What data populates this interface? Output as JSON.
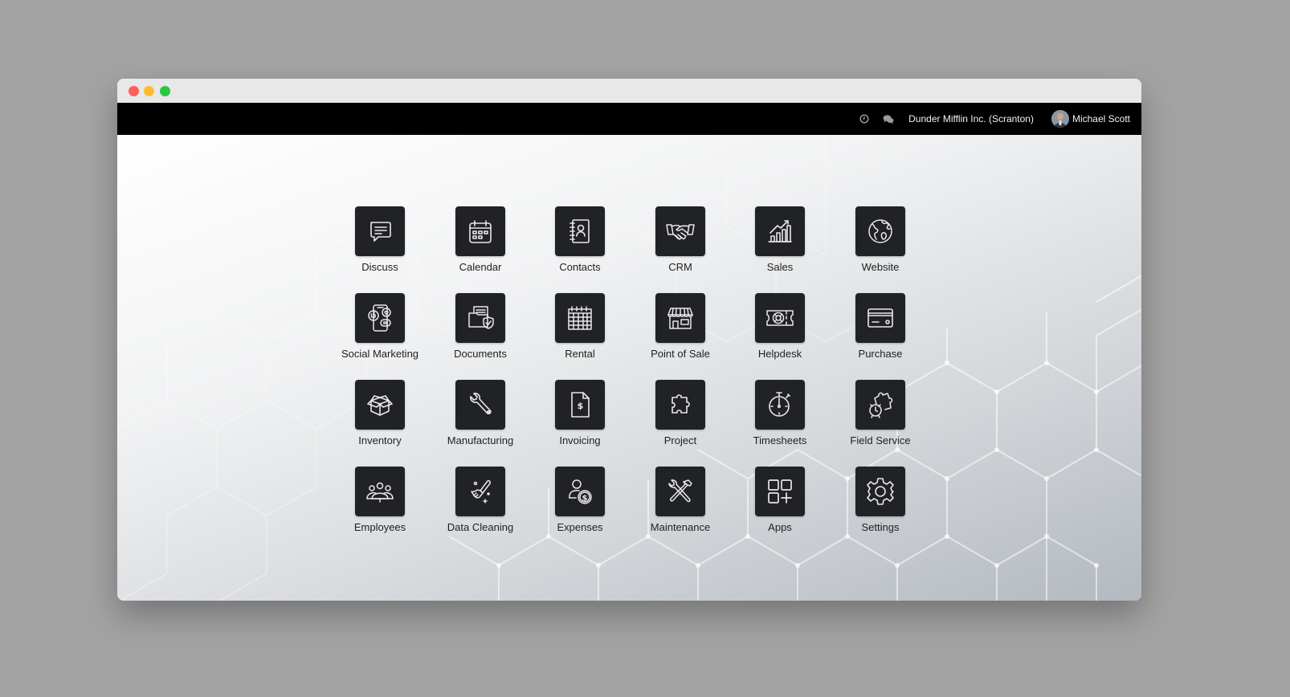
{
  "window": {
    "controls": [
      "close",
      "minimize",
      "maximize"
    ]
  },
  "navbar": {
    "icons": [
      "clock-icon",
      "chat-icon"
    ],
    "company": "Dunder Mifflin Inc. (Scranton)",
    "user": "Michael Scott"
  },
  "apps": [
    {
      "label": "Discuss",
      "icon": "chat-bubble-icon"
    },
    {
      "label": "Calendar",
      "icon": "calendar-icon"
    },
    {
      "label": "Contacts",
      "icon": "address-book-icon"
    },
    {
      "label": "CRM",
      "icon": "handshake-icon"
    },
    {
      "label": "Sales",
      "icon": "bar-chart-growth-icon"
    },
    {
      "label": "Website",
      "icon": "globe-icon"
    },
    {
      "label": "Social Marketing",
      "icon": "phone-social-icon"
    },
    {
      "label": "Documents",
      "icon": "folder-shield-icon"
    },
    {
      "label": "Rental",
      "icon": "rental-calendar-grid-icon"
    },
    {
      "label": "Point of Sale",
      "icon": "storefront-icon"
    },
    {
      "label": "Helpdesk",
      "icon": "lifebuoy-ticket-icon"
    },
    {
      "label": "Purchase",
      "icon": "credit-card-icon"
    },
    {
      "label": "Inventory",
      "icon": "box-icon"
    },
    {
      "label": "Manufacturing",
      "icon": "wrench-icon"
    },
    {
      "label": "Invoicing",
      "icon": "invoice-dollar-icon"
    },
    {
      "label": "Project",
      "icon": "puzzle-icon"
    },
    {
      "label": "Timesheets",
      "icon": "stopwatch-icon"
    },
    {
      "label": "Field Service",
      "icon": "puzzle-clock-icon"
    },
    {
      "label": "Employees",
      "icon": "people-group-icon"
    },
    {
      "label": "Data Cleaning",
      "icon": "brush-sparkle-icon"
    },
    {
      "label": "Expenses",
      "icon": "person-dollar-icon"
    },
    {
      "label": "Maintenance",
      "icon": "hammer-wrench-icon"
    },
    {
      "label": "Apps",
      "icon": "apps-plus-icon"
    },
    {
      "label": "Settings",
      "icon": "gear-icon"
    }
  ],
  "colors": {
    "tile": "#212226",
    "navbar": "#000000",
    "titlebar": "#e8e8e8",
    "close": "#fe5f57",
    "minimize": "#febc2e",
    "maximize": "#28c840"
  }
}
